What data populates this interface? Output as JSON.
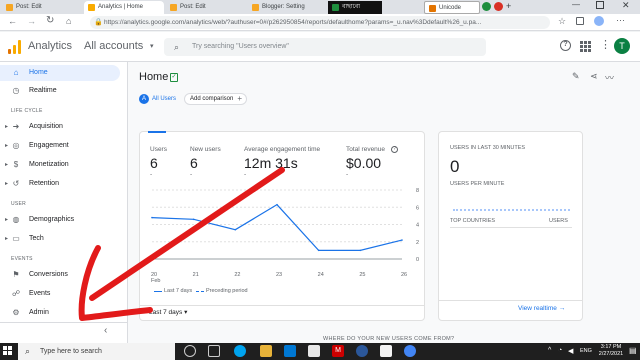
{
  "browser": {
    "tabs": [
      {
        "label": "Post: Edit",
        "color": "#f6a623"
      },
      {
        "label": "Analytics | Home",
        "color": "#f9ab00"
      },
      {
        "label": "Post: Edit",
        "color": "#f6a623"
      },
      {
        "label": "Blogger: Setting",
        "color": "#f6a623"
      },
      {
        "label": "বাছাবো",
        "color": "#1e8e3e"
      },
      {
        "label": "Unicode",
        "color": "#e37400"
      }
    ],
    "url": "https://analytics.google.com/analytics/web/?authuser=0#/p262950854/reports/defaulthome?params=_u.nav%3Ddefault%26_u.pa..."
  },
  "header": {
    "product": "Analytics",
    "account": "All accounts",
    "search_placeholder": "Try searching \"Users overview\"",
    "help_icon": "help-icon",
    "apps_icon": "apps-icon",
    "more_icon": "more-vert-icon",
    "avatar_letter": "T"
  },
  "sidebar": {
    "top": [
      {
        "label": "Home",
        "icon": "home-icon",
        "active": true
      },
      {
        "label": "Realtime",
        "icon": "realtime-icon"
      }
    ],
    "life_cycle_title": "LIFE CYCLE",
    "life_cycle": [
      {
        "label": "Acquisition",
        "icon": "acquisition-icon"
      },
      {
        "label": "Engagement",
        "icon": "engagement-icon"
      },
      {
        "label": "Monetization",
        "icon": "monetization-icon"
      },
      {
        "label": "Retention",
        "icon": "retention-icon"
      }
    ],
    "user_title": "USER",
    "user": [
      {
        "label": "Demographics",
        "icon": "globe-icon"
      },
      {
        "label": "Tech",
        "icon": "tech-icon"
      }
    ],
    "events_title": "EVENTS",
    "events": [
      {
        "label": "Conversions",
        "icon": "conversions-icon"
      },
      {
        "label": "Events",
        "icon": "events-icon"
      }
    ],
    "admin": {
      "label": "Admin",
      "icon": "gear-icon"
    },
    "collapse": "‹"
  },
  "main": {
    "title": "Home",
    "chip_all_users": "All Users",
    "chip_letter": "A",
    "add_comparison": "Add comparison",
    "metrics": [
      {
        "label": "Users",
        "value": "6",
        "delta": "-"
      },
      {
        "label": "New users",
        "value": "6",
        "delta": "-"
      },
      {
        "label": "Average engagement time",
        "value": "12m 31s",
        "delta": "-"
      },
      {
        "label": "Total revenue",
        "value": "$0.00",
        "delta": "-"
      }
    ],
    "legend_current": "Last 7 days",
    "legend_previous": "Preceding period",
    "date_range": "Last 7 days",
    "realtime": {
      "title": "USERS IN LAST 30 MINUTES",
      "value": "0",
      "per_minute": "USERS PER MINUTE",
      "col1": "TOP COUNTRIES",
      "col2": "USERS",
      "link": "View realtime"
    },
    "next_section": "WHERE DO YOUR NEW USERS COME FROM?"
  },
  "chart_data": {
    "type": "line",
    "categories": [
      "20 Feb",
      "21",
      "22",
      "23",
      "24",
      "25",
      "26"
    ],
    "series": [
      {
        "name": "Last 7 days",
        "values": [
          4.8,
          4.6,
          3.4,
          6.3,
          1.0,
          1.0,
          2.2
        ]
      }
    ],
    "ylim": [
      0,
      8
    ],
    "yticks": [
      0,
      2,
      4,
      6,
      8
    ],
    "legend": "bottom",
    "grid": true
  },
  "taskbar": {
    "search_placeholder": "Type here to search",
    "language": "ENG",
    "time": "3:17 PM",
    "date": "2/27/2021"
  }
}
